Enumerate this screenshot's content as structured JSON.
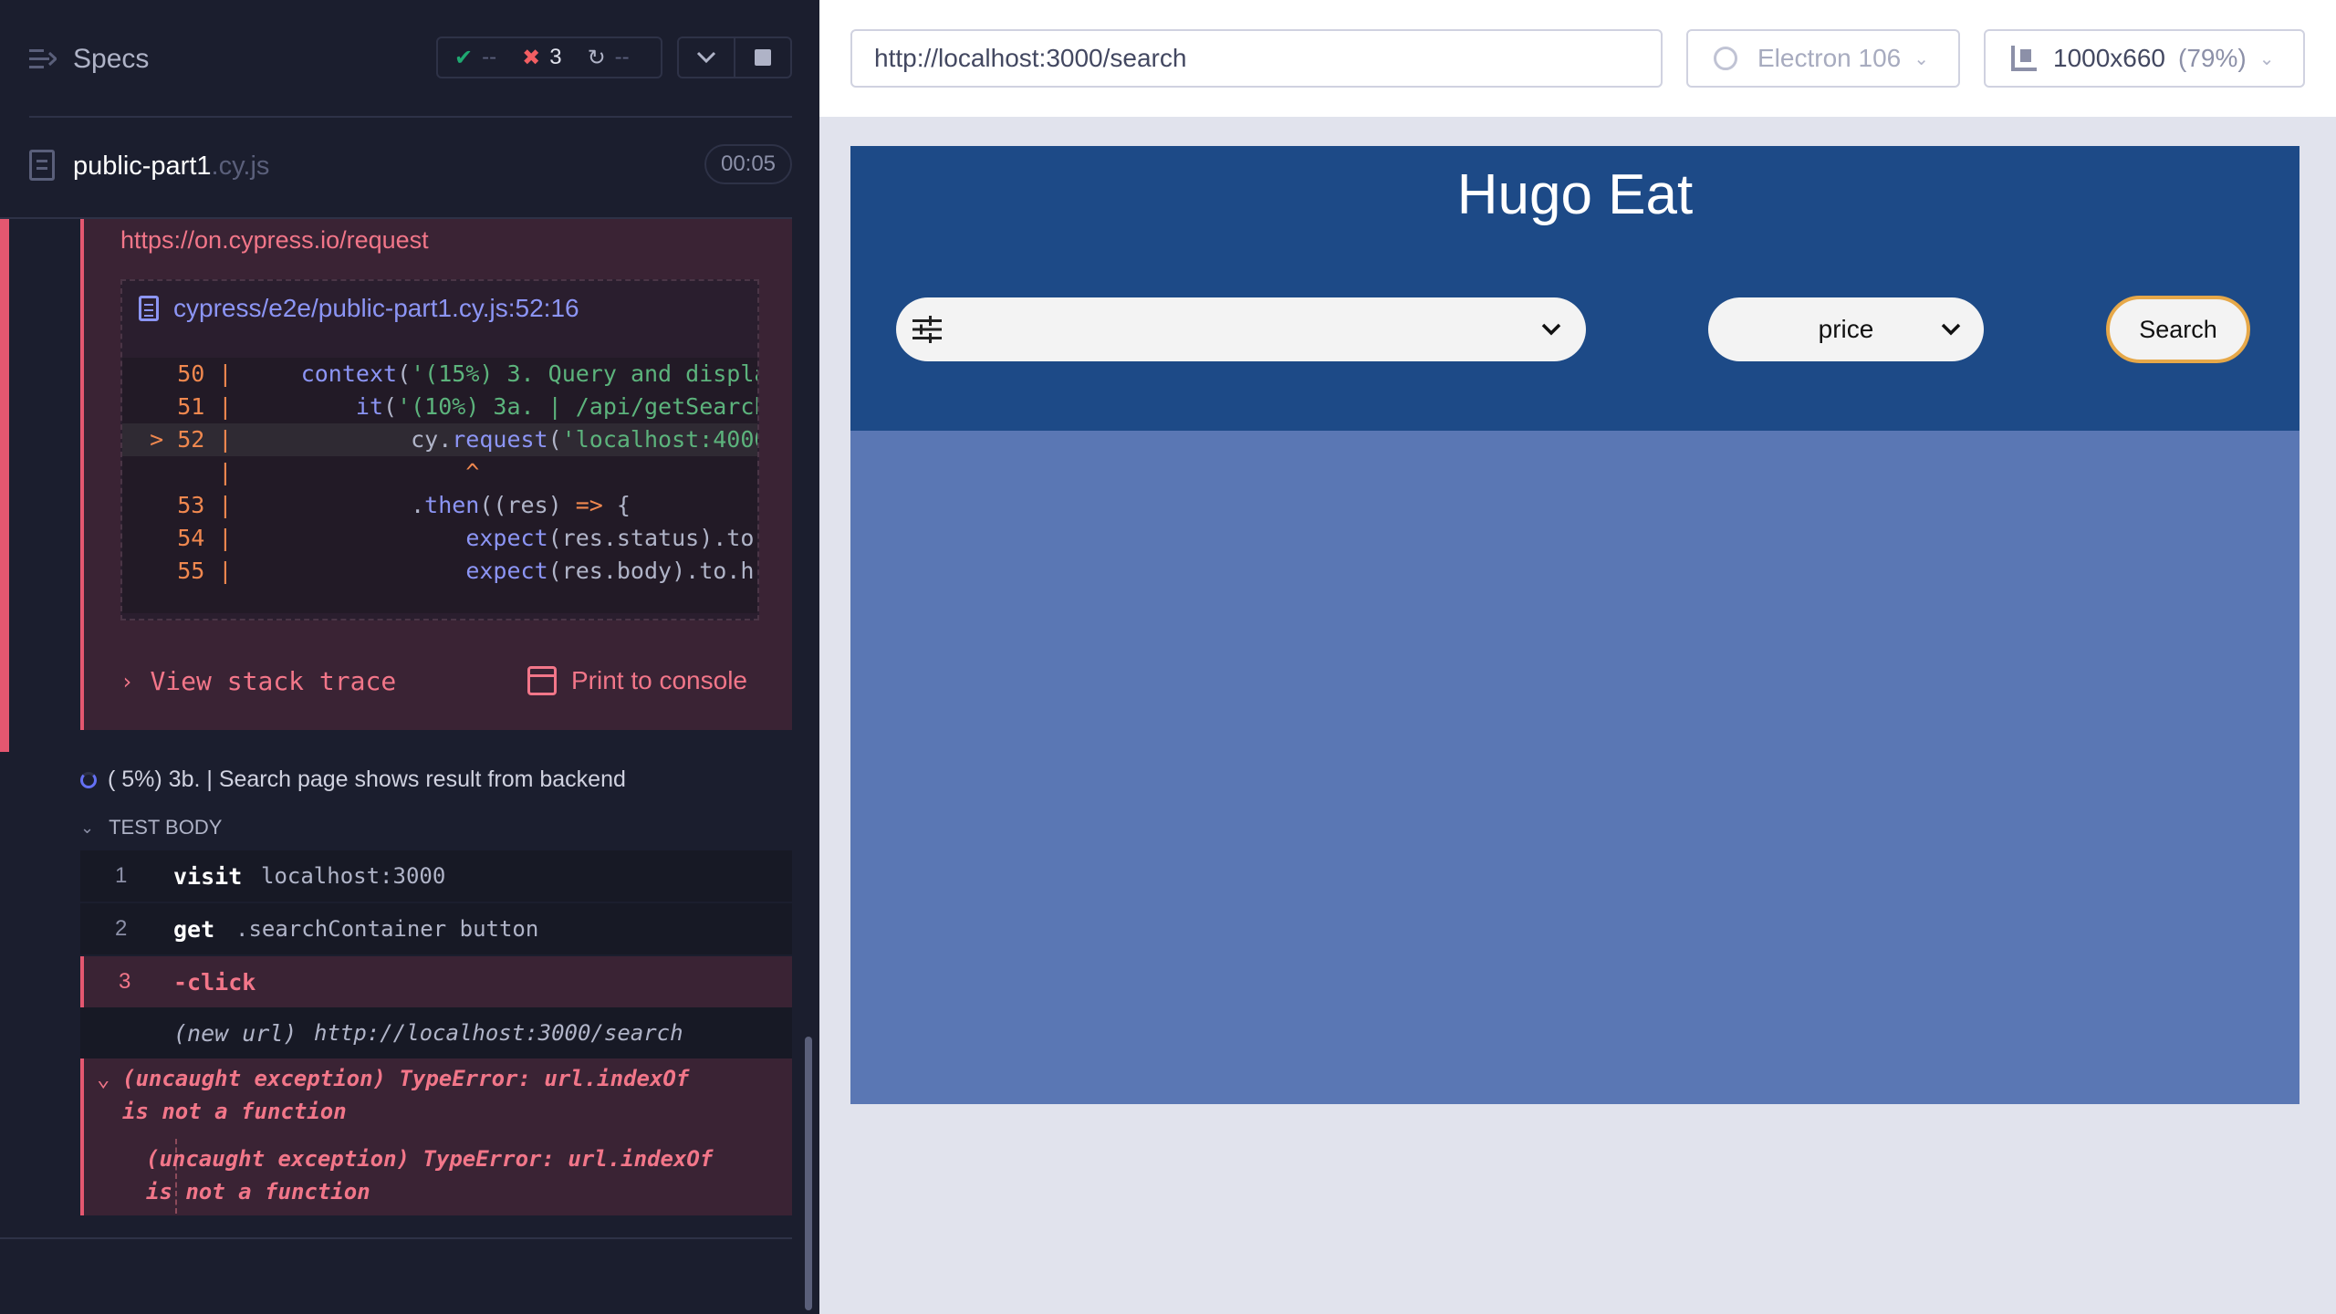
{
  "reporter": {
    "specs_label": "Specs",
    "stats": {
      "passed": "--",
      "failed": "3",
      "pending": "--"
    },
    "spec_file": {
      "name": "public-part1",
      "ext": ".cy.js",
      "duration": "00:05"
    },
    "error": {
      "link": "https://on.cypress.io/request",
      "code_file": "cypress/e2e/public-part1.cy.js:52:16",
      "view_stack_trace": "View stack trace",
      "print_to_console": "Print to console"
    },
    "test": {
      "title": "( 5%) 3b. | Search page shows result from backend",
      "body_label": "TEST BODY",
      "commands": [
        {
          "num": "1",
          "name": "visit",
          "message": "localhost:3000"
        },
        {
          "num": "2",
          "name": "get",
          "message": ".searchContainer button"
        },
        {
          "num": "3",
          "name": "-click",
          "message": ""
        },
        {
          "num": "",
          "name": "(new url)",
          "message": "http://localhost:3000/search"
        }
      ],
      "exception": {
        "line1": "(uncaught exception)  TypeError: url.indexOf",
        "line2": "is not a function",
        "inner_line1": "(uncaught exception)  TypeError: url.indexOf",
        "inner_line2": "is not a function"
      }
    }
  },
  "browser": {
    "url": "http://localhost:3000/search",
    "browser_name": "Electron 106",
    "viewport": "1000x660",
    "scale": "(79%)"
  },
  "app": {
    "title": "Hugo Eat",
    "price_label": "price",
    "search_label": "Search"
  },
  "colors": {
    "reporter_bg": "#1b1e2e",
    "error_accent": "#e45770",
    "app_header": "#1d4a87",
    "app_body": "#5a77b4",
    "search_border": "#e6a849"
  }
}
